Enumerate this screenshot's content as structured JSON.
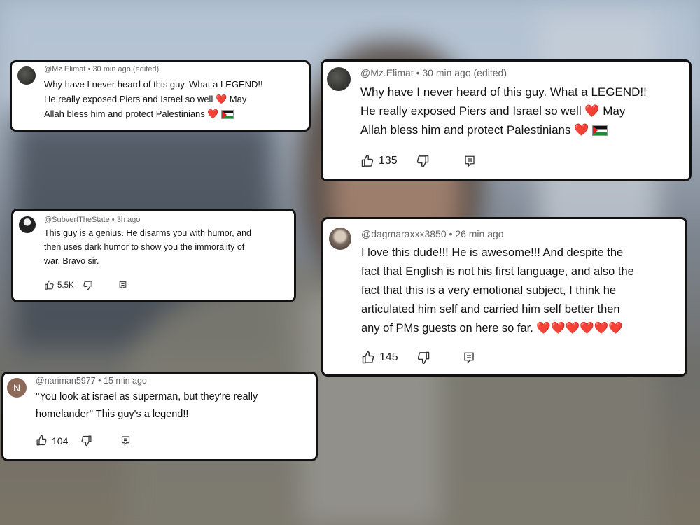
{
  "heart": "❤️",
  "comments": {
    "c1": {
      "author": "@Mz.Elimat",
      "time": "30 min ago (edited)",
      "line1": "Why have I never heard of this guy. What a LEGEND!!",
      "line2": "He really exposed Piers and Israel so well",
      "line2b": "May",
      "line3": "Allah bless him and protect Palestinians"
    },
    "c2": {
      "author": "@Mz.Elimat",
      "time": "30 min ago (edited)",
      "line1": "Why have I never heard of this guy. What a LEGEND!!",
      "line2": "He really exposed Piers and Israel so well",
      "line2b": "May",
      "line3": "Allah bless him and protect Palestinians",
      "likes": "135"
    },
    "c3": {
      "author": "@SubvertTheState",
      "time": "3h ago",
      "line1": "This guy is a genius. He disarms you with humor, and",
      "line2": "then uses dark humor to show you the immorality of",
      "line3": "war. Bravo sir.",
      "likes": "5.5K"
    },
    "c4": {
      "author": "@dagmaraxxx3850",
      "time": "26 min ago",
      "line1": "I love this dude!!! He is awesome!!! And despite the",
      "line2": "fact that English is not his first language, and also the",
      "line3": "fact that this is a very emotional subject, I think he",
      "line4": "articulated him self and carried him self better then",
      "line5": "any of PMs guests on here so far.",
      "likes": "145"
    },
    "c5": {
      "author": "@nariman5977",
      "time": "15 min ago",
      "avatar_letter": "N",
      "line1": "''You look at israel as superman, but they're really",
      "line2": "homelander''  This guy's a legend!!",
      "likes": "104"
    }
  },
  "separator": "•",
  "colors": {
    "heart": "#e23a3a",
    "avatar_n": "#8c6a5a"
  }
}
